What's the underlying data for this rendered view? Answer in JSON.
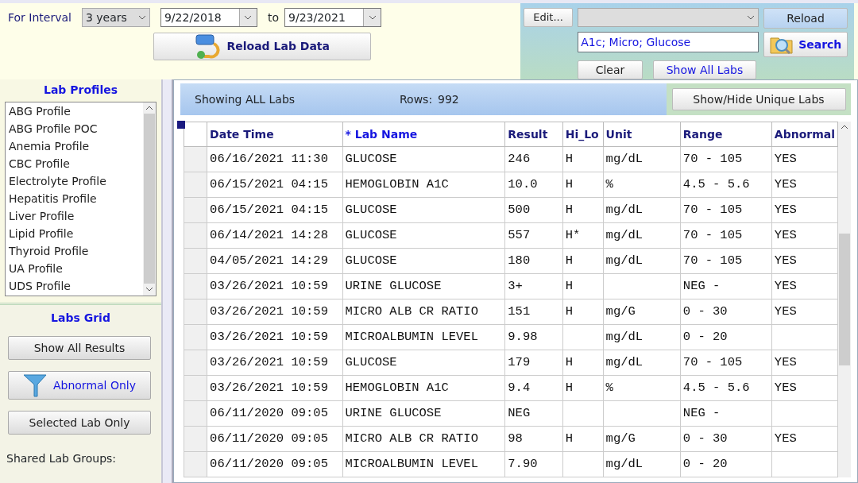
{
  "interval": {
    "label": "For Interval",
    "period": "3 years",
    "from": "9/22/2018",
    "to_label": "to",
    "to": "9/23/2021",
    "reload_button": "Reload Lab Data"
  },
  "search_panel": {
    "edit_button": "Edit...",
    "reload_button": "Reload",
    "search_value": "A1c; Micro; Glucose",
    "search_button": "Search",
    "clear_button": "Clear",
    "show_all_button": "Show All Labs"
  },
  "lab_profiles": {
    "title": "Lab Profiles",
    "items": [
      "ABG Profile",
      "ABG Profile POC",
      "Anemia Profile",
      "CBC Profile",
      "Electrolyte Profile",
      "Hepatitis Profile",
      "Liver Profile",
      "Lipid Profile",
      "Thyroid Profile",
      "UA Profile",
      "UDS Profile"
    ]
  },
  "labs_grid": {
    "title": "Labs Grid",
    "buttons": [
      {
        "label": "Show All Results",
        "kind": "plain"
      },
      {
        "label": "Abnormal Only",
        "kind": "filter"
      },
      {
        "label": "Selected Lab Only",
        "kind": "plain"
      }
    ],
    "shared_label": "Shared Lab Groups:"
  },
  "header": {
    "status": "Showing ALL Labs",
    "rows_label": "Rows:",
    "rows_count": "992",
    "toggle_button": "Show/Hide Unique Labs"
  },
  "table": {
    "columns": [
      {
        "label": "Date Time",
        "sorted": false
      },
      {
        "label": "* Lab Name",
        "sorted": true
      },
      {
        "label": "Result",
        "sorted": false
      },
      {
        "label": "Hi_Lo",
        "sorted": false
      },
      {
        "label": "Unit",
        "sorted": false
      },
      {
        "label": "Range",
        "sorted": false
      },
      {
        "label": "Abnormal",
        "sorted": false
      }
    ],
    "rows": [
      [
        "06/16/2021 11:30",
        "GLUCOSE",
        "246",
        "H",
        "mg/dL",
        "70 - 105",
        "YES"
      ],
      [
        "06/15/2021 04:15",
        "HEMOGLOBIN A1C",
        "10.0",
        "H",
        "%",
        "4.5 - 5.6",
        "YES"
      ],
      [
        "06/15/2021 04:15",
        "GLUCOSE",
        "500",
        "H",
        "mg/dL",
        "70 - 105",
        "YES"
      ],
      [
        "06/14/2021 14:28",
        "GLUCOSE",
        "557",
        "H*",
        "mg/dL",
        "70 - 105",
        "YES"
      ],
      [
        "04/05/2021 14:29",
        "GLUCOSE",
        "180",
        "H",
        "mg/dL",
        "70 - 105",
        "YES"
      ],
      [
        "03/26/2021 10:59",
        "URINE GLUCOSE",
        "3+",
        "H",
        "",
        "NEG -",
        "YES"
      ],
      [
        "03/26/2021 10:59",
        "MICRO ALB CR RATIO",
        "151",
        "H",
        "mg/G",
        "0 - 30",
        "YES"
      ],
      [
        "03/26/2021 10:59",
        "MICROALBUMIN LEVEL",
        "9.98",
        "",
        "mg/dL",
        "0 - 20",
        ""
      ],
      [
        "03/26/2021 10:59",
        "GLUCOSE",
        "179",
        "H",
        "mg/dL",
        "70 - 105",
        "YES"
      ],
      [
        "03/26/2021 10:59",
        "HEMOGLOBIN A1C",
        "9.4",
        "H",
        "%",
        "4.5 - 5.6",
        "YES"
      ],
      [
        "06/11/2020 09:05",
        "URINE GLUCOSE",
        "NEG",
        "",
        "",
        "NEG -",
        ""
      ],
      [
        "06/11/2020 09:05",
        "MICRO ALB CR RATIO",
        "98",
        "H",
        "mg/G",
        "0 - 30",
        "YES"
      ],
      [
        "06/11/2020 09:05",
        "MICROALBUMIN LEVEL",
        "7.90",
        "",
        "mg/dL",
        "0 - 20",
        ""
      ]
    ]
  }
}
